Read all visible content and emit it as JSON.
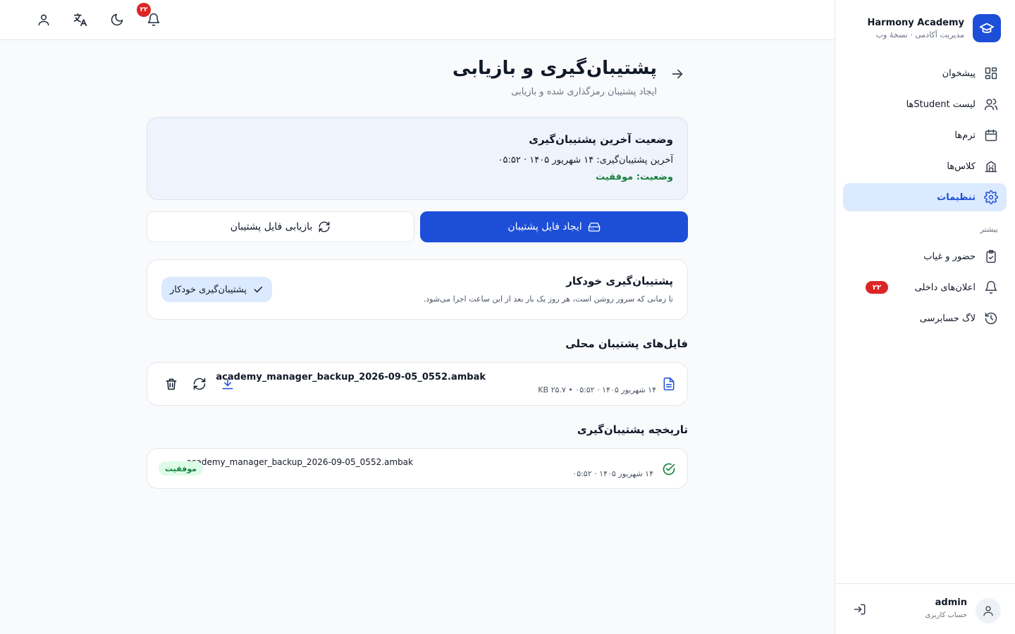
{
  "app": {
    "title": "Harmony Academy",
    "subtitle": "مدیریت آکادمی · نسخهٔ وب"
  },
  "sidebar": {
    "items": [
      {
        "label": "پیشخوان",
        "icon": "dashboard-icon"
      },
      {
        "label": "لیست Studentها",
        "icon": "users-icon"
      },
      {
        "label": "ترم‌ها",
        "icon": "calendar-icon"
      },
      {
        "label": "کلاس‌ها",
        "icon": "building-icon"
      },
      {
        "label": "تنظیمات",
        "icon": "gear-icon",
        "active": true
      }
    ],
    "more_label": "بیشتر",
    "more_items": [
      {
        "label": "حضور و غیاب",
        "icon": "clipboard-icon"
      },
      {
        "label": "اعلان‌های داخلی",
        "icon": "bell-icon",
        "badge": "۲۲"
      },
      {
        "label": "لاگ حسابرسی",
        "icon": "history-icon"
      }
    ],
    "user": {
      "name": "admin",
      "role": "حساب کاربری"
    }
  },
  "topbar": {
    "notification_count": "۲۲"
  },
  "page": {
    "title": "پشتیبان‌گیری و بازیابی",
    "subtitle": "ایجاد پشتیبان رمزگذاری شده و بازیابی"
  },
  "status": {
    "title": "وضعیت آخرین پشتیبان‌گیری",
    "last_backup": "آخرین پشتیبان‌گیری: ۱۴ شهریور ۱۴۰۵ · ۰۵:۵۲",
    "state": "وضعیت: موفقیت"
  },
  "actions": {
    "create_label": "ایجاد فایل پشتیبان",
    "restore_label": "بازیابی فایل پشتیبان"
  },
  "auto_backup": {
    "title": "پشتیبان‌گیری خودکار",
    "description": "تا زمانی که سرور روشن است، هر روز یک بار بعد از این ساعت اجرا می‌شود.",
    "chip_label": "پشتیبان‌گیری خودکار"
  },
  "local_files": {
    "title": "فایل‌های پشتیبان محلی",
    "items": [
      {
        "name": "academy_manager_backup_2026-09-05_0552.ambak",
        "meta": "۱۴ شهریور ۱۴۰۵ · ۰۵:۵۲ • ۲۵.۷ KB"
      }
    ]
  },
  "history": {
    "title": "تاریخچه پشتیبان‌گیری",
    "items": [
      {
        "name": "academy_manager_backup_2026-09-05_0552.ambak",
        "date": "۱۴ شهریور ۱۴۰۵ · ۰۵:۵۲",
        "status": "موفقیت"
      }
    ]
  },
  "colors": {
    "primary": "#1d4ed8",
    "active_bg": "#dbeafe",
    "success": "#15803d",
    "danger": "#dc2626"
  }
}
